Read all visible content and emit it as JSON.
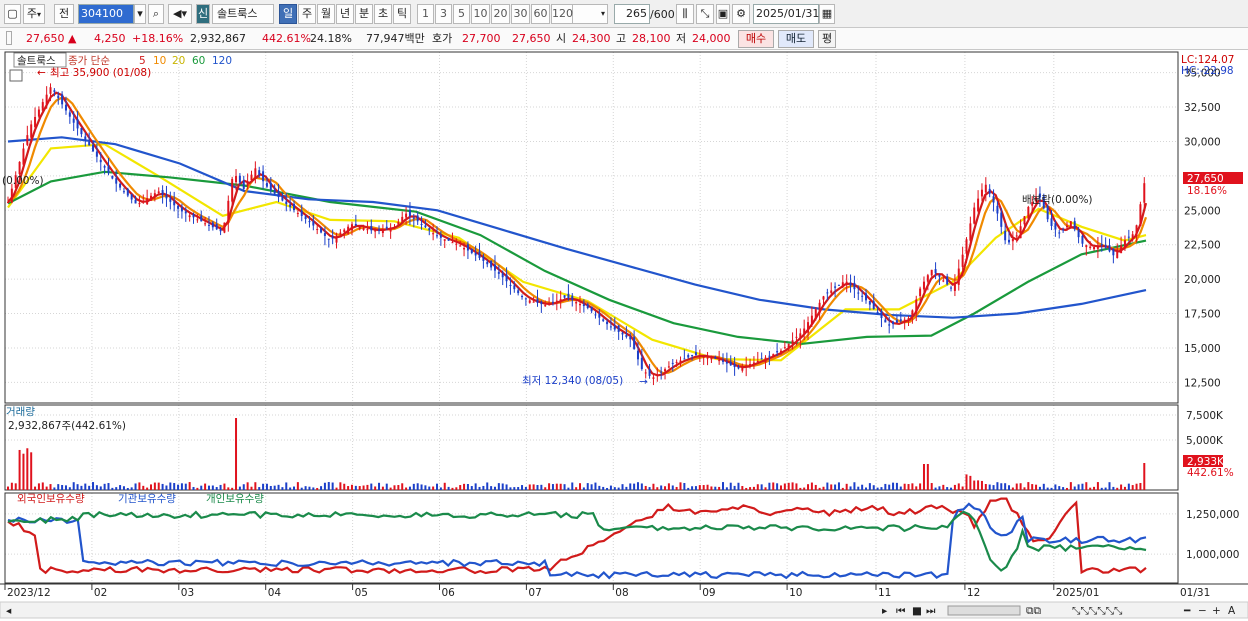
{
  "toolbar": {
    "mode": "주",
    "prev": "전",
    "code": "304100",
    "tag": "신",
    "name": "솔트룩스",
    "periods": [
      "일",
      "주",
      "월",
      "년",
      "분",
      "초",
      "틱"
    ],
    "nums": [
      "1",
      "3",
      "5",
      "10",
      "20",
      "30",
      "60",
      "120"
    ],
    "count": "265",
    "count_total": "/600",
    "date": "2025/01/31"
  },
  "info": {
    "price": "27,650",
    "arrow": "▲",
    "change": "4,250",
    "change_pct": "+18.16%",
    "volume": "2,932,867",
    "vol_pct": "442.61%",
    "turnover": "24.18%",
    "amount": "77,947백만",
    "ask_label": "호가",
    "ask1": "27,700",
    "bid1": "27,650",
    "open_label": "시",
    "open": "24,300",
    "high_label": "고",
    "high": "28,100",
    "low_label": "저",
    "low": "24,000",
    "buy": "매수",
    "sell": "매도",
    "avg": "평"
  },
  "price_pane": {
    "legend_name": "솔트룩스",
    "legend_ma": "종가 단순",
    "ma_periods": [
      "5",
      "10",
      "20",
      "60",
      "120"
    ],
    "ma_colors": [
      "#d11b1b",
      "#f08a00",
      "#f2e600",
      "#1a9a3c",
      "#2255cc"
    ],
    "high_note": "최고 35,900 (01/08)",
    "low_note": "최저 12,340 (08/05)",
    "left_note": "(0.00%)",
    "mid_note": "배분락(0.00%)",
    "lc": "LC:124.07",
    "hc": "HC:-22.98",
    "y_ticks": [
      "35,000",
      "32,500",
      "30,000",
      "27,500",
      "25,000",
      "22,500",
      "20,000",
      "17,500",
      "15,000",
      "12,500"
    ],
    "last_price": "27,650",
    "last_pct": "18.16%"
  },
  "volume_pane": {
    "title": "거래량",
    "value": "2,932,867주(442.61%)",
    "y_ticks": [
      "7,500K",
      "5,000K"
    ],
    "last": "2,933K",
    "last_pct": "442.61%"
  },
  "holding_pane": {
    "series": [
      "외국인보유수량",
      "기관보유수량",
      "개인보유수량"
    ],
    "colors": [
      "#d11b1b",
      "#2255cc",
      "#1a8a4a"
    ],
    "y_ticks": [
      "1,250,000",
      "1,000,000"
    ]
  },
  "x_axis": {
    "labels": [
      "2023/12",
      "02",
      "03",
      "04",
      "05",
      "06",
      "07",
      "08",
      "09",
      "10",
      "11",
      "12",
      "2025/01"
    ],
    "right": "01/31"
  },
  "chart_data": {
    "type": "candlestick",
    "title": "솔트룩스",
    "period": "일",
    "y_ticks": [
      35000,
      32500,
      30000,
      27500,
      25000,
      22500,
      20000,
      17500,
      15000,
      12500
    ],
    "ylim": [
      11000,
      36500
    ],
    "high": {
      "value": 35900,
      "date": "01/08"
    },
    "low": {
      "value": 12340,
      "date": "08/05"
    },
    "last": 27650,
    "close_path": [
      [
        0,
        25600
      ],
      [
        2,
        31000
      ],
      [
        4,
        34000
      ],
      [
        6,
        31500
      ],
      [
        8,
        29200
      ],
      [
        10,
        27000
      ],
      [
        12,
        25400
      ],
      [
        14,
        26400
      ],
      [
        16,
        25000
      ],
      [
        18,
        24200
      ],
      [
        20,
        23400
      ],
      [
        21,
        27800
      ],
      [
        22,
        26500
      ],
      [
        23,
        28100
      ],
      [
        24,
        26800
      ],
      [
        26,
        25400
      ],
      [
        28,
        24200
      ],
      [
        30,
        22800
      ],
      [
        32,
        24000
      ],
      [
        34,
        23500
      ],
      [
        36,
        23800
      ],
      [
        37,
        24800
      ],
      [
        38,
        24300
      ],
      [
        40,
        23100
      ],
      [
        42,
        22500
      ],
      [
        44,
        21500
      ],
      [
        46,
        20200
      ],
      [
        48,
        18600
      ],
      [
        50,
        18100
      ],
      [
        52,
        18700
      ],
      [
        54,
        17900
      ],
      [
        56,
        16600
      ],
      [
        58,
        15600
      ],
      [
        59,
        13500
      ],
      [
        60,
        12800
      ],
      [
        62,
        13900
      ],
      [
        64,
        14500
      ],
      [
        66,
        14200
      ],
      [
        68,
        13500
      ],
      [
        70,
        14100
      ],
      [
        72,
        14800
      ],
      [
        74,
        16200
      ],
      [
        76,
        18800
      ],
      [
        78,
        19900
      ],
      [
        80,
        18400
      ],
      [
        82,
        16600
      ],
      [
        84,
        17200
      ],
      [
        85,
        19400
      ],
      [
        86,
        20700
      ],
      [
        87,
        20000
      ],
      [
        88,
        19200
      ],
      [
        89,
        22000
      ],
      [
        90,
        25200
      ],
      [
        91,
        27000
      ],
      [
        92,
        25200
      ],
      [
        93,
        22500
      ],
      [
        94,
        23200
      ],
      [
        95,
        25200
      ],
      [
        96,
        26200
      ],
      [
        97,
        24000
      ],
      [
        98,
        23300
      ],
      [
        99,
        24200
      ],
      [
        100,
        22600
      ],
      [
        101,
        22300
      ],
      [
        102,
        22500
      ],
      [
        103,
        21700
      ],
      [
        104,
        22800
      ],
      [
        105,
        23400
      ],
      [
        106,
        27650
      ]
    ],
    "ma_paths": [
      {
        "name": "20",
        "color": "#f2e600",
        "points": [
          [
            0,
            25200
          ],
          [
            4,
            29500
          ],
          [
            9,
            29800
          ],
          [
            14,
            27500
          ],
          [
            20,
            24600
          ],
          [
            25,
            25600
          ],
          [
            30,
            24300
          ],
          [
            36,
            24200
          ],
          [
            42,
            23000
          ],
          [
            48,
            19800
          ],
          [
            54,
            18400
          ],
          [
            60,
            15600
          ],
          [
            66,
            14200
          ],
          [
            72,
            14100
          ],
          [
            78,
            17800
          ],
          [
            83,
            17800
          ],
          [
            88,
            19800
          ],
          [
            92,
            23000
          ],
          [
            96,
            25100
          ],
          [
            100,
            23800
          ],
          [
            104,
            22800
          ],
          [
            106,
            23200
          ]
        ]
      },
      {
        "name": "60",
        "color": "#1a9a3c",
        "points": [
          [
            0,
            25500
          ],
          [
            4,
            27100
          ],
          [
            9,
            27800
          ],
          [
            15,
            27400
          ],
          [
            22,
            26800
          ],
          [
            30,
            25600
          ],
          [
            38,
            24900
          ],
          [
            44,
            23200
          ],
          [
            50,
            20600
          ],
          [
            56,
            18500
          ],
          [
            62,
            16800
          ],
          [
            68,
            15800
          ],
          [
            74,
            15300
          ],
          [
            80,
            15800
          ],
          [
            86,
            15900
          ],
          [
            90,
            17500
          ],
          [
            95,
            19800
          ],
          [
            100,
            21800
          ],
          [
            106,
            22800
          ]
        ]
      },
      {
        "name": "120",
        "color": "#2255cc",
        "points": [
          [
            0,
            30000
          ],
          [
            5,
            30300
          ],
          [
            10,
            29800
          ],
          [
            16,
            28400
          ],
          [
            22,
            26400
          ],
          [
            28,
            25800
          ],
          [
            34,
            25600
          ],
          [
            40,
            25000
          ],
          [
            46,
            23600
          ],
          [
            52,
            22200
          ],
          [
            58,
            20900
          ],
          [
            64,
            19600
          ],
          [
            70,
            18500
          ],
          [
            76,
            17800
          ],
          [
            82,
            17400
          ],
          [
            88,
            17200
          ],
          [
            94,
            17500
          ],
          [
            100,
            18200
          ],
          [
            106,
            19200
          ]
        ]
      }
    ]
  }
}
